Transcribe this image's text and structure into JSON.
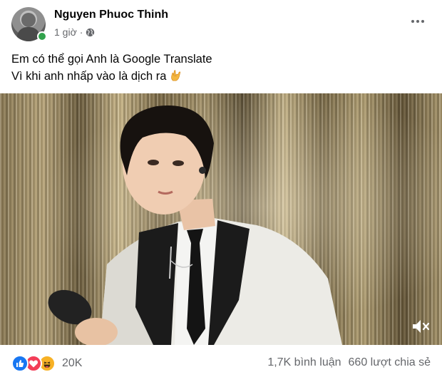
{
  "post": {
    "author": "Nguyen Phuoc Thinh",
    "time": "1 giờ",
    "separator": "·",
    "privacy_icon": "globe-icon",
    "caption_line1": "Em có thể gọi Anh là Google Translate",
    "caption_line2": "Vì khi anh nhấp vào là dịch ra",
    "caption_emoji": "love-you-gesture",
    "more_icon": "more-horizontal-icon"
  },
  "video": {
    "mute_icon": "speaker-muted-icon"
  },
  "footer": {
    "reaction_icons": [
      "like-icon",
      "love-icon",
      "haha-icon"
    ],
    "reaction_count": "20K",
    "comments": "1,7K bình luận",
    "shares": "660 lượt chia sẻ"
  },
  "colors": {
    "like": "#1877f2",
    "love": "#f33e58",
    "haha": "#f7b125",
    "online": "#31a24c",
    "secondary_text": "#65676b"
  }
}
